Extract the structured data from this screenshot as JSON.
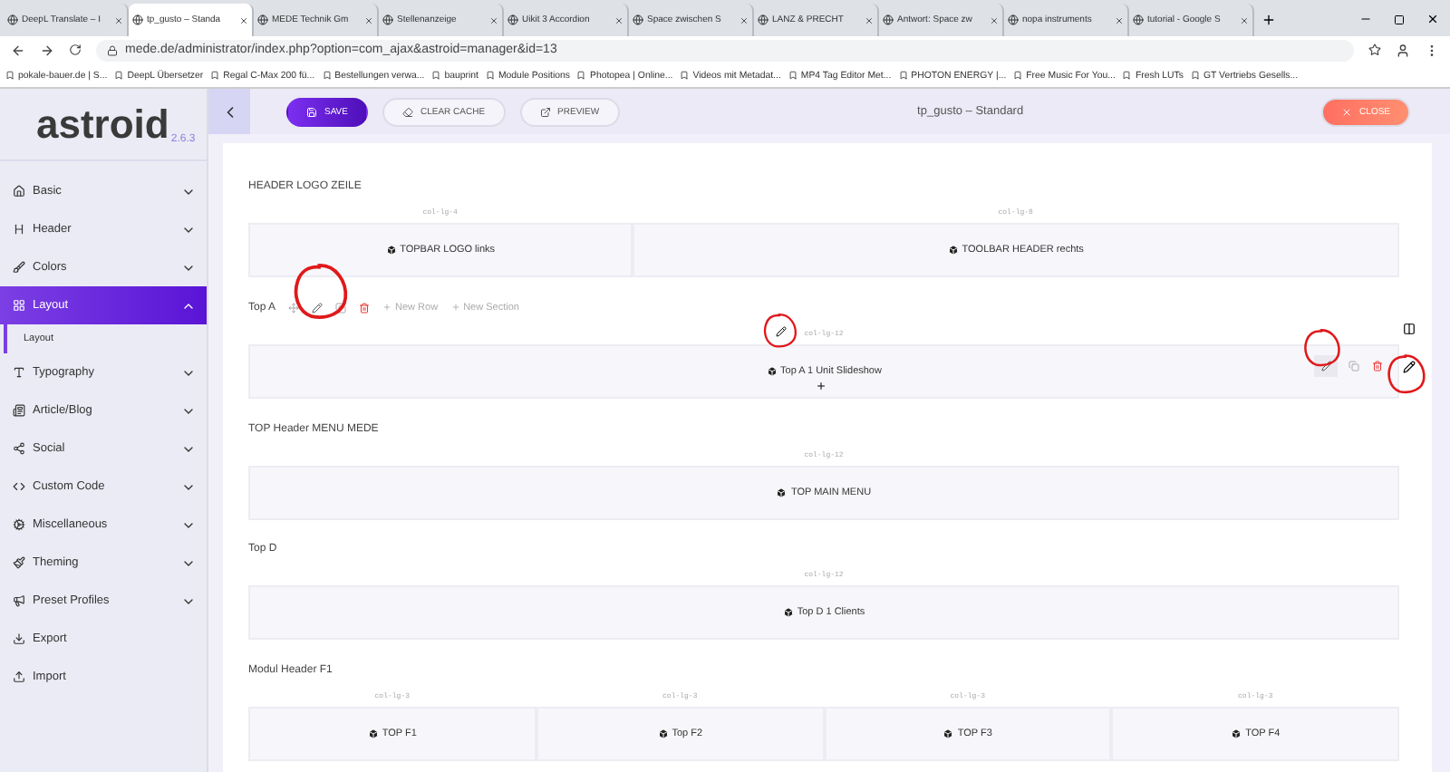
{
  "browser": {
    "tabs": [
      {
        "title": "DeepL Translate – I",
        "selected": false
      },
      {
        "title": "tp_gusto – Standa",
        "selected": true
      },
      {
        "title": "MEDE Technik Gm",
        "selected": false
      },
      {
        "title": "Stellenanzeige",
        "selected": false
      },
      {
        "title": "Uikit 3 Accordion",
        "selected": false
      },
      {
        "title": "Space zwischen S",
        "selected": false
      },
      {
        "title": "LANZ & PRECHT",
        "selected": false
      },
      {
        "title": "Antwort: Space zw",
        "selected": false
      },
      {
        "title": "nopa instruments",
        "selected": false
      },
      {
        "title": "tutorial - Google S",
        "selected": false
      }
    ],
    "url": "mede.de/administrator/index.php?option=com_ajax&astroid=manager&id=13",
    "bookmarks": [
      "pokale-bauer.de | S...",
      "DeepL Übersetzer",
      "Regal C-Max 200 fü...",
      "Bestellungen verwa...",
      "bauprint",
      "Module Positions",
      "Photopea | Online...",
      "Videos mit Metadat...",
      "MP4 Tag Editor Met...",
      "PHOTON ENERGY |...",
      "Free Music For You...",
      "Fresh LUTs",
      "GT Vertriebs Gesells..."
    ]
  },
  "logo": {
    "name": "astroid",
    "version": "2.6.3"
  },
  "toolbar": {
    "save": "SAVE",
    "clear_cache": "CLEAR CACHE",
    "preview": "PREVIEW",
    "title": "tp_gusto – Standard",
    "close": "CLOSE"
  },
  "sidebar": {
    "items": [
      {
        "label": "Basic",
        "kind": "group",
        "expanded": false,
        "selected": false
      },
      {
        "label": "Header",
        "kind": "group",
        "expanded": false,
        "selected": false
      },
      {
        "label": "Colors",
        "kind": "group",
        "expanded": false,
        "selected": false
      },
      {
        "label": "Layout",
        "kind": "group",
        "expanded": true,
        "selected": true,
        "children": [
          {
            "label": "Layout"
          }
        ]
      },
      {
        "label": "Typography",
        "kind": "group",
        "expanded": false,
        "selected": false
      },
      {
        "label": "Article/Blog",
        "kind": "group",
        "expanded": false,
        "selected": false
      },
      {
        "label": "Social",
        "kind": "group",
        "expanded": false,
        "selected": false
      },
      {
        "label": "Custom Code",
        "kind": "group",
        "expanded": false,
        "selected": false
      },
      {
        "label": "Miscellaneous",
        "kind": "group",
        "expanded": false,
        "selected": false
      },
      {
        "label": "Theming",
        "kind": "group",
        "expanded": false,
        "selected": false
      },
      {
        "label": "Preset Profiles",
        "kind": "group",
        "expanded": false,
        "selected": false
      },
      {
        "label": "Export",
        "kind": "action",
        "selected": false
      },
      {
        "label": "Import",
        "kind": "action",
        "selected": false
      }
    ]
  },
  "sections": [
    {
      "title": "HEADER LOGO ZEILE",
      "columns": [
        {
          "size": "col-lg-4",
          "label": "TOPBAR LOGO links"
        },
        {
          "size": "col-lg-8",
          "label": "TOOLBAR HEADER rechts"
        }
      ]
    },
    {
      "title": "Top A",
      "tools": {
        "new_row": "New Row",
        "new_section": "New Section"
      },
      "hovered": true,
      "columns": [
        {
          "size": "col-lg-12",
          "label": "Top A 1 Unit Slideshow"
        }
      ]
    },
    {
      "title": "TOP Header MENU MEDE",
      "columns": [
        {
          "size": "col-lg-12",
          "label": "TOP MAIN MENU"
        }
      ]
    },
    {
      "title": "Top D",
      "columns": [
        {
          "size": "col-lg-12",
          "label": "Top D 1 Clients"
        }
      ]
    },
    {
      "title": "Modul Header F1",
      "columns": [
        {
          "size": "col-lg-3",
          "label": "TOP F1"
        },
        {
          "size": "col-lg-3",
          "label": "Top F2"
        },
        {
          "size": "col-lg-3",
          "label": "TOP F3"
        },
        {
          "size": "col-lg-3",
          "label": "TOP F4"
        }
      ]
    }
  ]
}
